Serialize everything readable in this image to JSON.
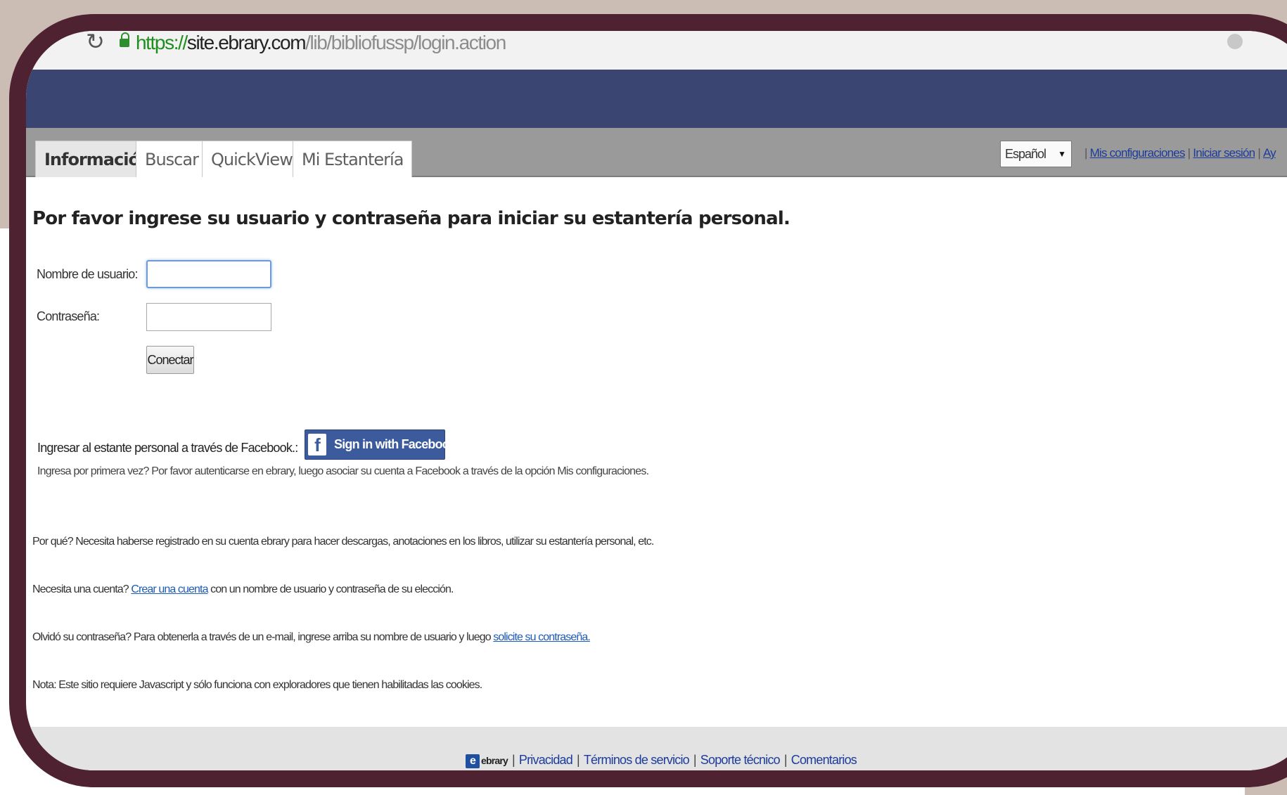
{
  "browser": {
    "url_scheme": "https://",
    "url_host": "site.ebrary.com",
    "url_path": "/lib/bibliofussp/login.action"
  },
  "tabs": [
    {
      "label": "Información",
      "active": true
    },
    {
      "label": "Buscar",
      "active": false
    },
    {
      "label": "QuickView",
      "active": false
    },
    {
      "label": "Mi Estantería",
      "active": false
    }
  ],
  "top_nav": {
    "language_value": "Español",
    "separator": "|",
    "links": [
      "Mis configuraciones",
      "Iniciar sesión",
      "Ay"
    ]
  },
  "login": {
    "heading": "Por favor ingrese su usuario y contraseña para iniciar su estantería personal.",
    "username_label": "Nombre de usuario:",
    "username_value": "",
    "password_label": "Contraseña:",
    "password_value": "",
    "connect_button": "Conectar"
  },
  "facebook": {
    "label": "Ingresar al estante personal a través de Facebook.:",
    "button_letter": "f",
    "button_label": "Sign in with Facebook",
    "note": "Ingresa por primera vez? Por favor autenticarse en ebrary, luego asociar su cuenta a Facebook a través de la opción Mis configuraciones."
  },
  "info": {
    "why": "Por qué? Necesita haberse registrado en su cuenta ebrary para hacer descargas, anotaciones en los libros, utilizar su estantería personal, etc.",
    "need_account_prefix": "Necesita una cuenta?",
    "need_account_link": "Crear una cuenta",
    "need_account_suffix": "con un nombre de usuario y contraseña de su elección.",
    "forgot_prefix": "Olvidó su contraseña? Para obtenerla a través de un e-mail, ingrese arriba su nombre de usuario y luego",
    "forgot_link": "solicite su contraseña.",
    "note": "Nota: Este sitio requiere Javascript y sólo funciona con exploradores que tienen habilitadas las cookies."
  },
  "footer": {
    "logo_text": "ebrary",
    "separator": "|",
    "links": [
      "Privacidad",
      "Términos de servicio",
      "Soporte técnico",
      "Comentarios"
    ]
  },
  "colors": {
    "frame": "#4f2231",
    "backdrop": "#cbbdb4",
    "header_band": "#3a4572",
    "facebook_blue": "#3b5b9d",
    "link": "#1c3c9c"
  }
}
